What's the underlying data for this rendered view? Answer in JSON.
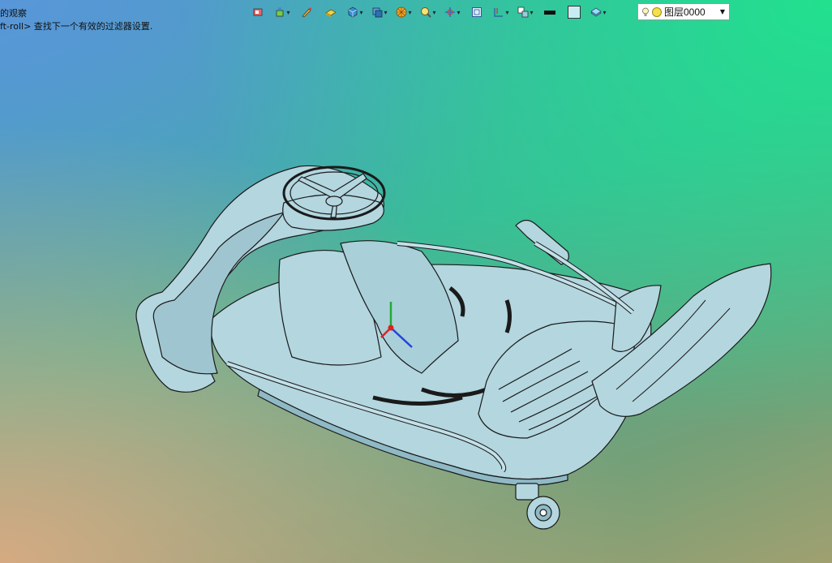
{
  "status": {
    "line1": "的观察",
    "line2": "ft-roll> 查找下一个有效的过滤器设置."
  },
  "toolbar": {
    "buttons": [
      {
        "name": "view-icon"
      },
      {
        "name": "render-mode-icon"
      },
      {
        "name": "pen-icon"
      },
      {
        "name": "solid-shaded-icon"
      },
      {
        "name": "cube-view-icon"
      },
      {
        "name": "view-cube-2-icon"
      },
      {
        "name": "color-wheel-icon"
      },
      {
        "name": "zoom-icon"
      },
      {
        "name": "rotate-icon"
      },
      {
        "name": "fit-view-icon"
      },
      {
        "name": "section-icon"
      },
      {
        "name": "grid-icon"
      },
      {
        "name": "line-color-icon"
      },
      {
        "name": "fill-color-icon"
      },
      {
        "name": "layer-state-icon"
      }
    ],
    "colors": {
      "line_color": "#111111",
      "fill_color": "#c8ecf4"
    }
  },
  "layer": {
    "value": "图层0000"
  },
  "model": {
    "body_color": "#b3d6df",
    "edge_color": "#1a1a1a",
    "triad": {
      "x": "#2244dd",
      "y": "#22aa33",
      "z": "#dd2222"
    }
  }
}
